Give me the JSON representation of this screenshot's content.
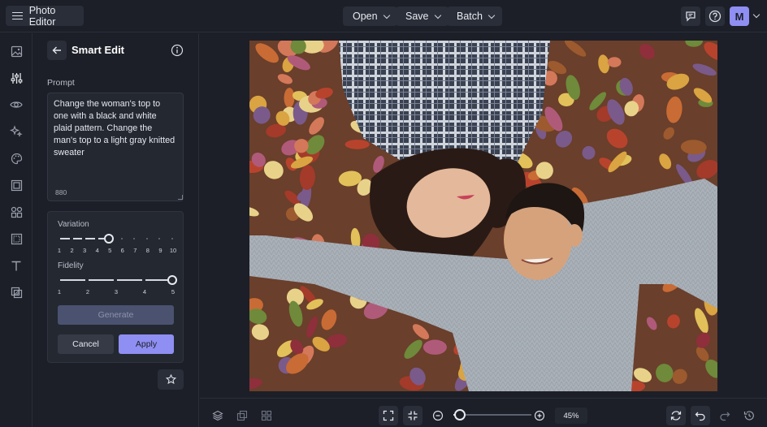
{
  "app": {
    "title": "Photo Editor",
    "avatar_initial": "M",
    "accent": "#8f8ef2"
  },
  "header": {
    "menus": [
      {
        "label": "Open"
      },
      {
        "label": "Save"
      },
      {
        "label": "Batch"
      }
    ],
    "icons": [
      "feedback-icon",
      "help-icon"
    ]
  },
  "rail": {
    "items": [
      "image-icon",
      "adjustments-icon",
      "eye-icon",
      "effects-icon",
      "palette-icon",
      "frame-icon",
      "shapes-icon",
      "crop-icon",
      "text-icon",
      "layers-overlay-icon"
    ]
  },
  "panel": {
    "title": "Smart Edit",
    "prompt_label": "Prompt",
    "prompt_text": "Change the woman's top to one with a black and white plaid pattern. Change the man's top to a light gray knitted sweater",
    "char_count": "880",
    "variation": {
      "label": "Variation",
      "ticks": [
        "1",
        "2",
        "3",
        "4",
        "5",
        "6",
        "7",
        "8",
        "9",
        "10"
      ],
      "value": 5
    },
    "fidelity": {
      "label": "Fidelity",
      "ticks": [
        "1",
        "2",
        "3",
        "4",
        "5"
      ],
      "value": 5
    },
    "generate_label": "Generate",
    "cancel_label": "Cancel",
    "apply_label": "Apply"
  },
  "bottom": {
    "zoom": "45%"
  }
}
